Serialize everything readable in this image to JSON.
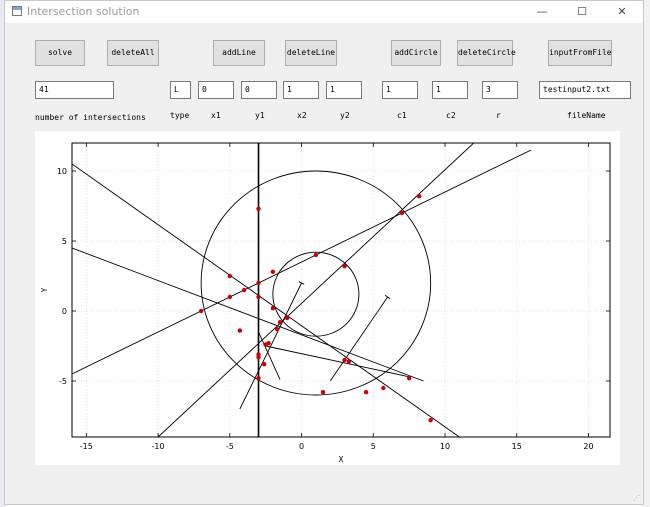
{
  "window": {
    "title": "Intersection solution",
    "minimize_glyph": "—",
    "maximize_glyph": "☐",
    "close_glyph": "✕"
  },
  "buttons": {
    "solve": "solve",
    "delete_all": "deleteAll",
    "add_line": "addLine",
    "delete_line": "deleteLine",
    "add_circle": "addCircle",
    "delete_circle": "deleteCircle",
    "input_from_file": "inputFromFile"
  },
  "fields": {
    "intersections": "41",
    "type": "L",
    "x1": "0",
    "y1": "0",
    "x2": "1",
    "y2": "1",
    "c1": "1",
    "c2": "1",
    "r": "3",
    "file_name": "testinput2.txt"
  },
  "labels": {
    "intersections": "number of intersections",
    "type": "type",
    "x1": "x1",
    "y1": "y1",
    "x2": "x2",
    "y2": "y2",
    "c1": "c1",
    "c2": "c2",
    "r": "r",
    "file_name": "fileName"
  },
  "chart_data": {
    "type": "scatter",
    "xlabel": "X",
    "ylabel": "Y",
    "xlim": [
      -16,
      21.5
    ],
    "ylim": [
      -9,
      12
    ],
    "xticks": [
      -15,
      -10,
      -5,
      0,
      5,
      10,
      15,
      20
    ],
    "yticks": [
      -5,
      0,
      5,
      10
    ],
    "grid": true,
    "colors": {
      "lines": "#000000",
      "points": "#cc0000",
      "grid": "#cccccc"
    },
    "lines": [
      {
        "a": [
          -3,
          -9
        ],
        "b": [
          -3,
          12
        ]
      },
      {
        "a": [
          -16,
          10.5
        ],
        "b": [
          11,
          -9
        ]
      },
      {
        "a": [
          -16,
          -4.5
        ],
        "b": [
          16,
          11.5
        ]
      },
      {
        "a": [
          -16,
          4.5
        ],
        "b": [
          8.5,
          -5
        ]
      },
      {
        "a": [
          -10,
          -9
        ],
        "b": [
          12,
          12
        ]
      }
    ],
    "rays": [
      {
        "a": [
          -3,
          -1.5
        ],
        "b": [
          -1.5,
          -4.9
        ]
      },
      {
        "a": [
          -2.5,
          -2.5
        ],
        "b": [
          7.5,
          -4.7
        ]
      }
    ],
    "segments": [
      {
        "a": [
          0,
          2
        ],
        "b": [
          -4.3,
          -7
        ]
      },
      {
        "a": [
          6,
          1
        ],
        "b": [
          2,
          -5
        ]
      }
    ],
    "circles": [
      {
        "cx": 1,
        "cy": 2,
        "r": 8
      },
      {
        "cx": 1,
        "cy": 1.2,
        "r": 3
      }
    ],
    "points": [
      [
        -3,
        7.3
      ],
      [
        -7,
        0
      ],
      [
        -5,
        2.5
      ],
      [
        -4,
        1.5
      ],
      [
        -5,
        1
      ],
      [
        -3,
        2
      ],
      [
        -3,
        1
      ],
      [
        -4.3,
        -1.4
      ],
      [
        -2,
        2.8
      ],
      [
        -1,
        -0.5
      ],
      [
        -1.5,
        -0.8
      ],
      [
        -2,
        0.2
      ],
      [
        -1.7,
        -1.3
      ],
      [
        -2.3,
        -2.3
      ],
      [
        -2.5,
        -2.4
      ],
      [
        -3,
        -3.1
      ],
      [
        -3,
        -3.3
      ],
      [
        -2.6,
        -3.8
      ],
      [
        -3,
        -4.8
      ],
      [
        1,
        4
      ],
      [
        3,
        3.2
      ],
      [
        7,
        7
      ],
      [
        8.2,
        8.2
      ],
      [
        3,
        -3.5
      ],
      [
        3.3,
        -3.6
      ],
      [
        1.5,
        -5.8
      ],
      [
        4.5,
        -5.8
      ],
      [
        5.7,
        -5.5
      ],
      [
        7.5,
        -4.8
      ],
      [
        9,
        -7.8
      ]
    ]
  }
}
